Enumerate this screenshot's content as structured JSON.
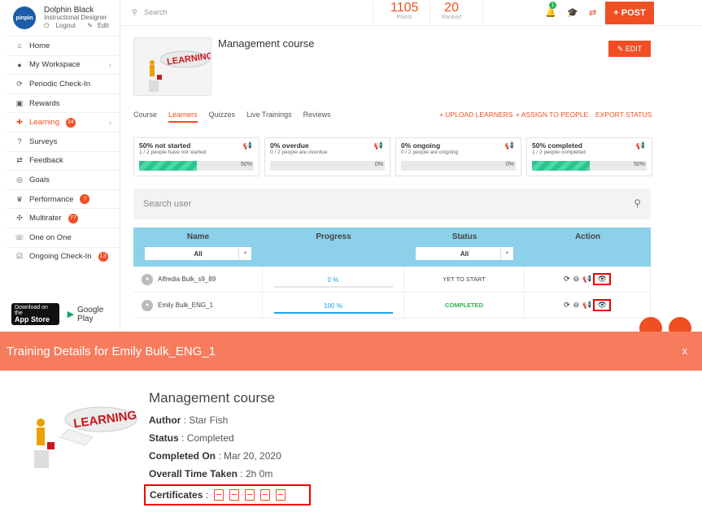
{
  "profile": {
    "name": "Dolphin Black",
    "role": "Instructional Designer",
    "logout": "Logout",
    "edit": "Edit",
    "avatar_text": "pinpin"
  },
  "sidebar": {
    "items": [
      {
        "label": "Home",
        "icon": "home-icon"
      },
      {
        "label": "My Workspace",
        "icon": "person-icon"
      },
      {
        "label": "Periodic Check-In",
        "icon": "cycle-icon"
      },
      {
        "label": "Rewards",
        "icon": "gift-icon"
      },
      {
        "label": "Learning",
        "icon": "learning-icon",
        "badge": "24"
      },
      {
        "label": "Surveys",
        "icon": "question-icon"
      },
      {
        "label": "Feedback",
        "icon": "arrows-icon"
      },
      {
        "label": "Goals",
        "icon": "target-icon"
      },
      {
        "label": "Performance",
        "icon": "trophy-icon",
        "badge": "7"
      },
      {
        "label": "Multirater",
        "icon": "multirater-icon",
        "badge": "77"
      },
      {
        "label": "One on One",
        "icon": "chat-icon"
      },
      {
        "label": "Ongoing Check-In",
        "icon": "calendar-check-icon",
        "badge": "13"
      }
    ],
    "app_store_small": "Download on the",
    "app_store": "App Store",
    "google_play": "Google Play"
  },
  "header": {
    "search_placeholder": "Search",
    "points_value": "1105",
    "points_label": "Points",
    "ranked_value": "20",
    "ranked_label": "Ranked",
    "notification_count": "1",
    "post_label": "+ POST"
  },
  "course": {
    "title": "Management course",
    "edit_label": "EDIT",
    "thumb_text": "LEARNING",
    "tabs": [
      "Course",
      "Learners",
      "Quizzes",
      "Live Trainings",
      "Reviews"
    ],
    "actions": [
      "+ UPLOAD LEARNERS",
      "+ ASSIGN TO PEOPLE",
      "EXPORT STATUS"
    ]
  },
  "cards": [
    {
      "title": "50% not started",
      "sub": "1 / 2 people have not started",
      "pct_text": "50%",
      "fill": 0.5
    },
    {
      "title": "0% overdue",
      "sub": "0 / 2 people are overdue",
      "pct_text": "0%",
      "fill": 0
    },
    {
      "title": "0% ongoing",
      "sub": "0 / 2 people are ongoing",
      "pct_text": "0%",
      "fill": 0
    },
    {
      "title": "50% completed",
      "sub": "1 / 2 people completed",
      "pct_text": "50%",
      "fill": 0.5
    }
  ],
  "search_user_placeholder": "Search user",
  "table": {
    "headers": [
      "Name",
      "Progress",
      "Status",
      "Action"
    ],
    "filter_name": "All",
    "filter_status": "All",
    "rows": [
      {
        "name": "Alfredia Bulk_s9_89",
        "progress": "0 %",
        "progress_value": 0,
        "status": "YET TO START"
      },
      {
        "name": "Emily Bulk_ENG_1",
        "progress": "100 %",
        "progress_value": 1,
        "status": "COMPLETED"
      }
    ]
  },
  "modal": {
    "title": "Training Details for Emily Bulk_ENG_1",
    "close": "x",
    "course_title": "Management course",
    "author_label": "Author",
    "author_value": "Star Fish",
    "status_label": "Status",
    "status_value": "Completed",
    "completed_label": "Completed On",
    "completed_value": "Mar 20, 2020",
    "time_label": "Overall Time Taken",
    "time_value": "2h 0m",
    "certificates_label": "Certificates",
    "certificate_count": 5
  },
  "colors": {
    "accent": "#f04e23",
    "modal_header": "#f77c5e",
    "table_header": "#8dd0ea",
    "progress": "#1aa3e8",
    "completed": "#2db34a"
  }
}
